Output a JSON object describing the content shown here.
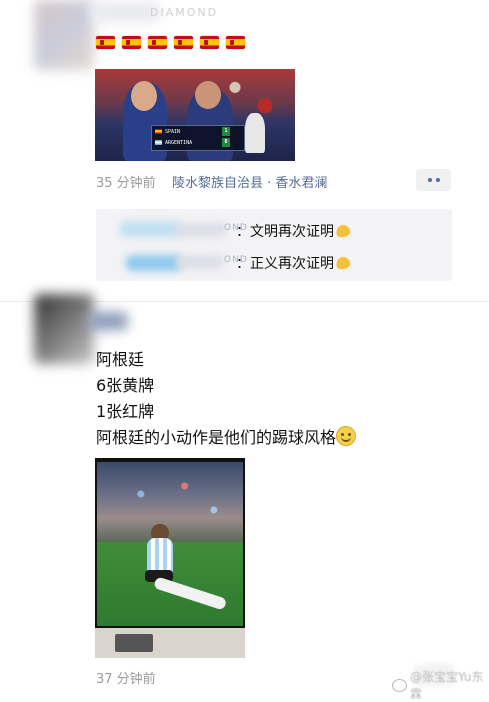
{
  "post1": {
    "author_tail": "DIAMOND",
    "flags_count": 6,
    "flag_emoji_name": "spain-flag",
    "photo": {
      "score_team_1": "SPAIN",
      "score_team_2": "ARGENTINA",
      "score_1": "1",
      "score_2": "0"
    },
    "time": "35 分钟前",
    "location": "陵水黎族自治县 · 香水君澜",
    "more_icon": "more-dots-icon",
    "comments": [
      {
        "name_tail": "OND",
        "text": "：文明再次证明"
      },
      {
        "name_tail": "OND",
        "text": "：正义再次证明"
      }
    ]
  },
  "post2": {
    "lines": [
      "阿根廷",
      "6张黄牌",
      "1张红牌",
      "阿根廷的小动作是他们的踢球风格"
    ],
    "time": "37 分钟前"
  },
  "watermark": {
    "text": "@张宝宝Yu东霖"
  },
  "colors": {
    "link_blue": "#576b95",
    "meta_gray": "#9a9a9a",
    "comment_bg": "#f3f3f5"
  }
}
